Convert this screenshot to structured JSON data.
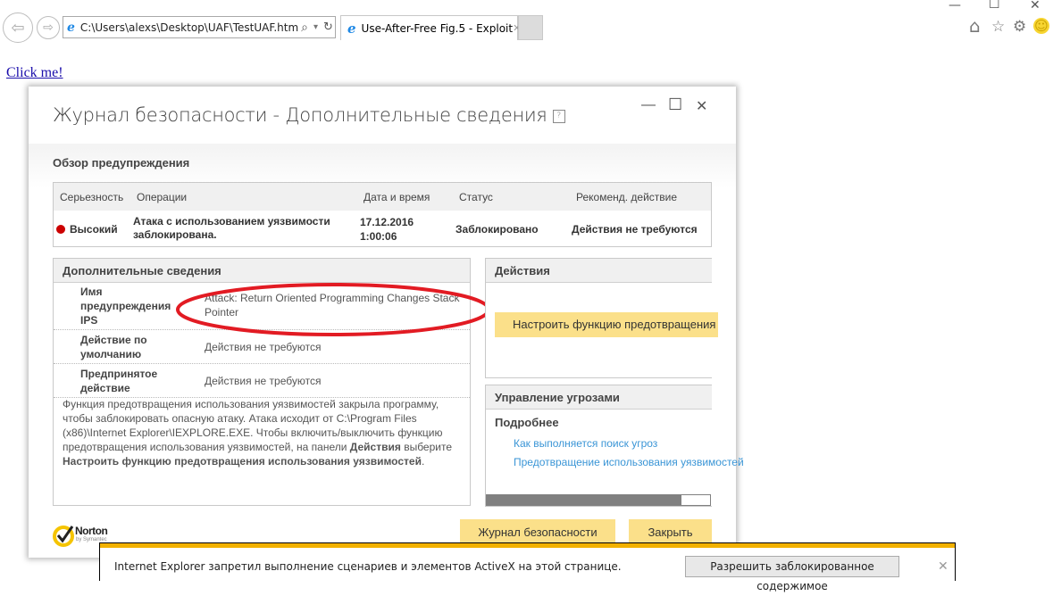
{
  "browser": {
    "address": "C:\\Users\\alexs\\Desktop\\UAF\\TestUAF.htm",
    "tab_title": "Use-After-Free Fig.5 - Exploit",
    "search_glyph": "⌕",
    "dropdown_glyph": "▾",
    "refresh_glyph": "↻",
    "back_glyph": "⇦",
    "forward_glyph": "⇨",
    "tab_close_glyph": "✕",
    "window_controls": {
      "minimize": "—",
      "maximize": "☐",
      "close": "✕"
    },
    "toolbar_icons": {
      "home": "⌂",
      "favorites": "☆",
      "settings": "⚙",
      "feedback": "☺"
    }
  },
  "page": {
    "link_text": "Click me!"
  },
  "dialog": {
    "title": "Журнал безопасности - Дополнительные сведения",
    "help": "?",
    "controls": {
      "minimize": "—",
      "maximize": "☐",
      "close": "✕"
    },
    "overview_heading": "Обзор предупреждения",
    "table": {
      "headers": [
        "Серьезность",
        "Операции",
        "Дата и время",
        "Статус",
        "Рекоменд. действие"
      ],
      "row": {
        "severity": "Высокий",
        "severity_color": "#cc0000",
        "operation_line1": "Атака с использованием уязвимости",
        "operation_line2": "заблокирована.",
        "date": "17.12.2016",
        "time": "1:00:06",
        "status": "Заблокировано",
        "action": "Действия не требуются"
      }
    },
    "details": {
      "heading": "Дополнительные сведения",
      "rows": [
        {
          "label_lines": [
            "Имя",
            "предупреждения",
            "IPS"
          ],
          "value_lines": [
            "Attack: Return Oriented Programming Changes Stack",
            "Pointer"
          ]
        },
        {
          "label_lines": [
            "Действие по",
            "умолчанию"
          ],
          "value_lines": [
            "Действия не требуются"
          ]
        },
        {
          "label_lines": [
            "Предпринятое",
            "действие"
          ],
          "value_lines": [
            "Действия не требуются"
          ]
        }
      ],
      "description_lines": [
        "Функция предотвращения использования уязвимостей закрыла программу,",
        "чтобы заблокировать опасную атаку. Атака исходит от C:\\Program Files",
        "(x86)\\Internet Explorer\\IEXPLORE.EXE. Чтобы включить/выключить функцию"
      ],
      "description_line4_pre": "предотвращения использования уязвимостей, на панели ",
      "description_line4_bold": "Действия",
      "description_line4_post": " выберите",
      "description_line5_bold": "Настроить функцию предотвращения использования уязвимостей",
      "description_line5_post": "."
    },
    "actions": {
      "heading": "Действия",
      "button": "Настроить функцию предотвращения использования уязвимостей"
    },
    "threats": {
      "heading": "Управление угрозами",
      "subheading": "Подробнее",
      "links": [
        "Как выполняется поиск угроз",
        "Предотвращение использования уязвимостей"
      ],
      "scroll_position": 0.87
    },
    "footer": {
      "brand": "Norton",
      "brand_sub": "by Symantec",
      "log_button": "Журнал безопасности",
      "close_button": "Закрыть"
    },
    "annotation_color": "#e21b23"
  },
  "notification": {
    "text": "Internet Explorer запретил выполнение сценариев и элементов ActiveX на этой странице.",
    "allow_button": "Разрешить заблокированное содержимое",
    "close_glyph": "✕"
  }
}
